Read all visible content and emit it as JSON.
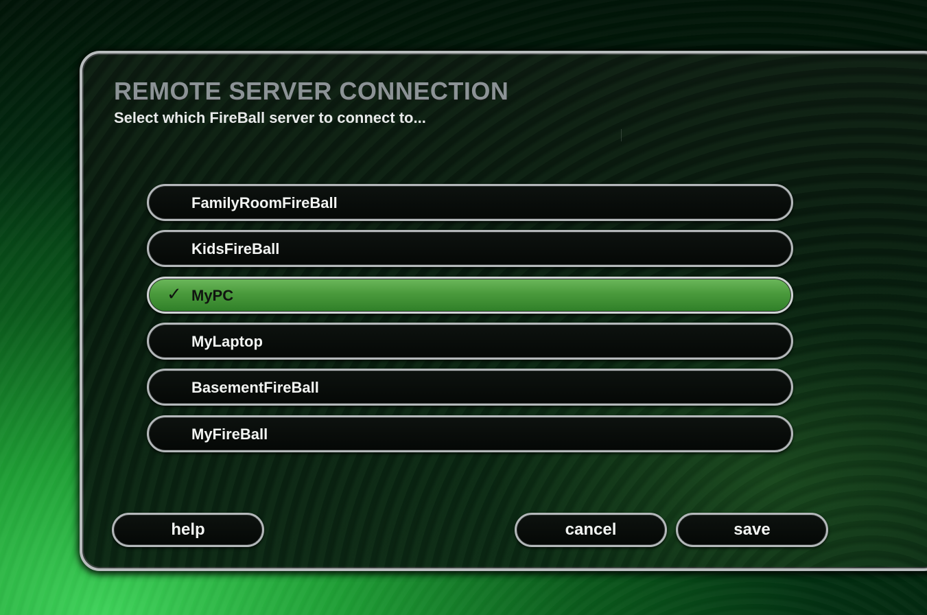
{
  "header": {
    "title": "REMOTE SERVER CONNECTION",
    "subtitle": "Select which FireBall server to connect to..."
  },
  "servers": [
    {
      "label": "FamilyRoomFireBall",
      "selected": false
    },
    {
      "label": "KidsFireBall",
      "selected": false
    },
    {
      "label": "MyPC",
      "selected": true
    },
    {
      "label": "MyLaptop",
      "selected": false
    },
    {
      "label": "BasementFireBall",
      "selected": false
    },
    {
      "label": "MyFireBall",
      "selected": false
    }
  ],
  "selected_mark": "✓",
  "buttons": {
    "help": "help",
    "cancel": "cancel",
    "save": "save"
  },
  "colors": {
    "selected_fill": "#4a9a3c",
    "border": "#b4b8ba",
    "background_green": "#1f9e35"
  },
  "icons": {
    "check": "check-icon"
  }
}
